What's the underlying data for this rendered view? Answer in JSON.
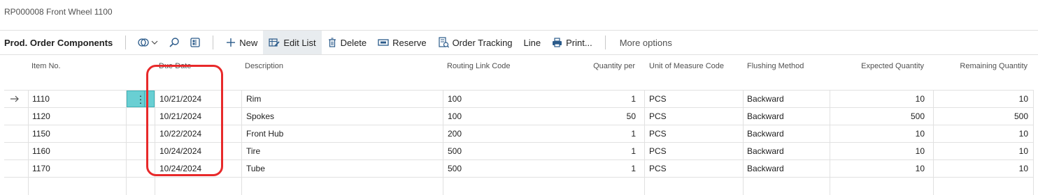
{
  "page": {
    "title": "RP000008 Front Wheel 1100"
  },
  "toolbar": {
    "caption": "Prod. Order Components",
    "new_label": "New",
    "edit_list_label": "Edit List",
    "delete_label": "Delete",
    "reserve_label": "Reserve",
    "order_tracking_label": "Order Tracking",
    "line_label": "Line",
    "print_label": "Print...",
    "more_options_label": "More options"
  },
  "columns": {
    "item_no": "Item No.",
    "due_date": "Due Date",
    "description": "Description",
    "routing_link_code": "Routing Link Code",
    "quantity_per": "Quantity per",
    "uom_code": "Unit of Measure Code",
    "flushing_method": "Flushing Method",
    "expected_quantity": "Expected Quantity",
    "remaining_quantity": "Remaining Quantity"
  },
  "rows": [
    {
      "item_no": "1110",
      "due_date": "10/21/2024",
      "description": "Rim",
      "routing_link_code": "100",
      "quantity_per": "1",
      "uom_code": "PCS",
      "flushing_method": "Backward",
      "expected_quantity": "10",
      "remaining_quantity": "10"
    },
    {
      "item_no": "1120",
      "due_date": "10/21/2024",
      "description": "Spokes",
      "routing_link_code": "100",
      "quantity_per": "50",
      "uom_code": "PCS",
      "flushing_method": "Backward",
      "expected_quantity": "500",
      "remaining_quantity": "500"
    },
    {
      "item_no": "1150",
      "due_date": "10/22/2024",
      "description": "Front Hub",
      "routing_link_code": "200",
      "quantity_per": "1",
      "uom_code": "PCS",
      "flushing_method": "Backward",
      "expected_quantity": "10",
      "remaining_quantity": "10"
    },
    {
      "item_no": "1160",
      "due_date": "10/24/2024",
      "description": "Tire",
      "routing_link_code": "500",
      "quantity_per": "1",
      "uom_code": "PCS",
      "flushing_method": "Backward",
      "expected_quantity": "10",
      "remaining_quantity": "10"
    },
    {
      "item_no": "1170",
      "due_date": "10/24/2024",
      "description": "Tube",
      "routing_link_code": "500",
      "quantity_per": "1",
      "uom_code": "PCS",
      "flushing_method": "Backward",
      "expected_quantity": "10",
      "remaining_quantity": "10"
    }
  ],
  "selected_row_index": 0,
  "annotation": {
    "color": "#e8292a",
    "highlighted_column": "Due Date"
  },
  "colors": {
    "accent": "#69cfd3",
    "active_button_bg": "#e8ecef",
    "gridline": "#e1e1e1"
  }
}
